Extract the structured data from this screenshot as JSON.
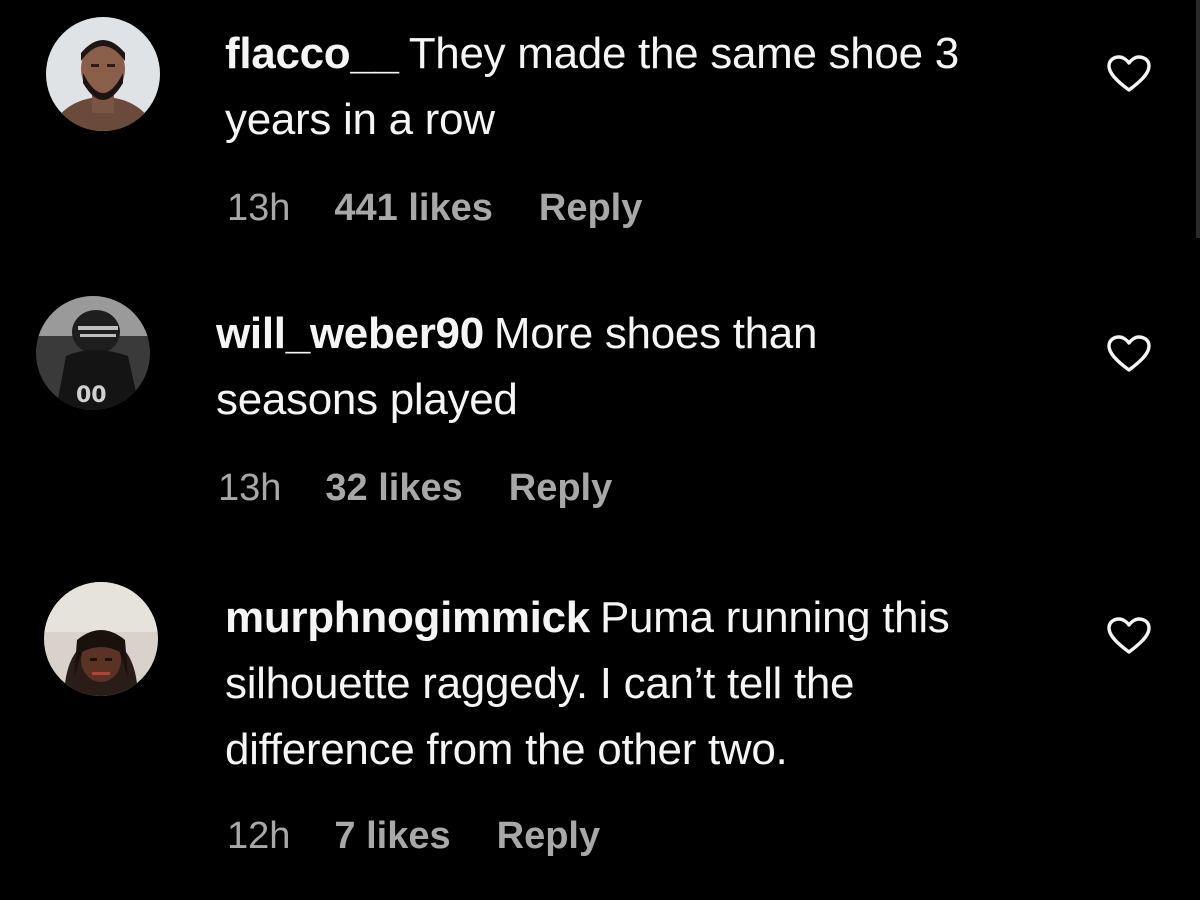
{
  "comments": [
    {
      "username": "flacco__",
      "text": "They made the same shoe 3 years in a row",
      "time": "13h",
      "likes": "441 likes",
      "reply": "Reply",
      "avatar": "profile-photo-man-beard"
    },
    {
      "username": "will_weber90",
      "text": "More shoes than seasons played",
      "time": "13h",
      "likes": "32 likes",
      "reply": "Reply",
      "avatar": "profile-photo-football-player"
    },
    {
      "username": "murphnogimmick",
      "text": "Puma running this silhouette raggedy. I can’t tell the difference from the other two.",
      "time": "12h",
      "likes": "7 likes",
      "reply": "Reply",
      "avatar": "profile-photo-man-locs"
    }
  ],
  "icons": {
    "like": "heart-outline-icon"
  },
  "colors": {
    "background": "#000000",
    "text": "#f5f5f5",
    "meta": "#a8a8a8"
  }
}
